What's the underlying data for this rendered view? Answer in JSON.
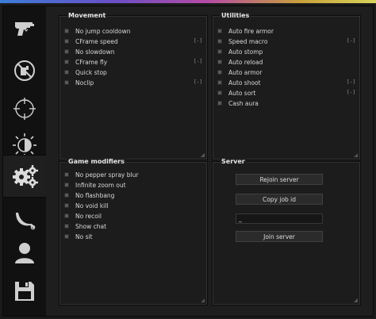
{
  "colors": {
    "accent_gradient": [
      "#3b7dd8",
      "#6a4fc7",
      "#b54aa5",
      "#c8a13a",
      "#d8d45a"
    ],
    "icon": "#cfcfcf"
  },
  "sidebar": {
    "tabs": [
      {
        "icon": "pistol-icon",
        "active": false
      },
      {
        "icon": "no-spray-icon",
        "active": false
      },
      {
        "icon": "crosshair-icon",
        "active": false
      },
      {
        "icon": "brightness-icon",
        "active": false
      },
      {
        "icon": "gears-icon",
        "active": true
      },
      {
        "icon": "karambit-icon",
        "active": false
      },
      {
        "icon": "user-icon",
        "active": false
      },
      {
        "icon": "floppy-disk-icon",
        "active": false
      }
    ]
  },
  "movement": {
    "title": "Movement",
    "items": [
      {
        "label": "No jump cooldown",
        "key": ""
      },
      {
        "label": "CFrame speed",
        "key": "[-]"
      },
      {
        "label": "No slowdown",
        "key": ""
      },
      {
        "label": "CFrame fly",
        "key": "[-]"
      },
      {
        "label": "Quick stop",
        "key": ""
      },
      {
        "label": "Noclip",
        "key": "[-]"
      }
    ]
  },
  "utilities": {
    "title": "Utilities",
    "items": [
      {
        "label": "Auto fire armor",
        "key": ""
      },
      {
        "label": "Speed macro",
        "key": "[-]"
      },
      {
        "label": "Auto stomp",
        "key": ""
      },
      {
        "label": "Auto reload",
        "key": ""
      },
      {
        "label": "Auto armor",
        "key": ""
      },
      {
        "label": "Auto shoot",
        "key": "[-]"
      },
      {
        "label": "Auto sort",
        "key": "[-]"
      },
      {
        "label": "Cash aura",
        "key": ""
      }
    ]
  },
  "game_modifiers": {
    "title": "Game modifiers",
    "items": [
      {
        "label": "No pepper spray blur"
      },
      {
        "label": "Infinite zoom out"
      },
      {
        "label": "No flashbang"
      },
      {
        "label": "No void kill"
      },
      {
        "label": "No recoil"
      },
      {
        "label": "Show chat"
      },
      {
        "label": "No sit"
      }
    ]
  },
  "server": {
    "title": "Server",
    "rejoin_label": "Rejoin server",
    "copy_job_label": "Copy job id",
    "job_input_value": "_",
    "join_label": "Join server"
  }
}
